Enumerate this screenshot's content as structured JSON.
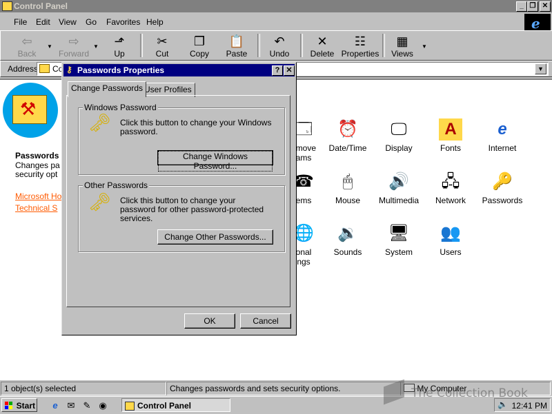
{
  "window": {
    "title": "Control Panel"
  },
  "menu": [
    "File",
    "Edit",
    "View",
    "Go",
    "Favorites",
    "Help"
  ],
  "toolbar": [
    {
      "label": "Back",
      "icon": "⇦",
      "disabled": true
    },
    {
      "label": "Forward",
      "icon": "⇨",
      "disabled": true
    },
    {
      "label": "Up",
      "icon": "⬏",
      "disabled": false
    },
    {
      "label": "Cut",
      "icon": "✂",
      "disabled": false
    },
    {
      "label": "Copy",
      "icon": "❐",
      "disabled": false
    },
    {
      "label": "Paste",
      "icon": "📋",
      "disabled": false
    },
    {
      "label": "Undo",
      "icon": "↶",
      "disabled": false
    },
    {
      "label": "Delete",
      "icon": "✕",
      "disabled": false
    },
    {
      "label": "Properties",
      "icon": "☷",
      "disabled": false
    },
    {
      "label": "Views",
      "icon": "▦",
      "disabled": false
    }
  ],
  "address": {
    "label": "Address",
    "value": "Co"
  },
  "sidebar": {
    "title": "Passwords",
    "desc_lines": [
      "Changes pa",
      "security opt"
    ],
    "links": [
      "Microsoft Ho",
      "Technical S"
    ]
  },
  "icons": [
    {
      "label": "emove",
      "label2": "ams",
      "glyph": "🗔"
    },
    {
      "label": "Date/Time",
      "glyph": "⏰"
    },
    {
      "label": "Display",
      "glyph": "🖵"
    },
    {
      "label": "Fonts",
      "glyph": "A"
    },
    {
      "label": "Internet",
      "glyph": "e"
    },
    {
      "label": "ems",
      "glyph": "☎"
    },
    {
      "label": "Mouse",
      "glyph": "🖱"
    },
    {
      "label": "Multimedia",
      "glyph": "🔊"
    },
    {
      "label": "Network",
      "glyph": "🖧"
    },
    {
      "label": "Passwords",
      "glyph": "🔑"
    },
    {
      "label": "onal",
      "label2": "ngs",
      "glyph": "🌐"
    },
    {
      "label": "Sounds",
      "glyph": "🔉"
    },
    {
      "label": "System",
      "glyph": "🖥"
    },
    {
      "label": "Users",
      "glyph": "👥"
    }
  ],
  "status": {
    "left": "1 object(s) selected",
    "mid": "Changes passwords and sets security options.",
    "right": "My Computer"
  },
  "taskbar": {
    "start": "Start",
    "task": "Control Panel",
    "clock": "12:41 PM"
  },
  "dialog": {
    "title": "Passwords Properties",
    "tabs": [
      "Change Passwords",
      "User Profiles"
    ],
    "windows_group": {
      "legend": "Windows Password",
      "text": "Click this button to change your Windows password.",
      "button": "Change Windows Password..."
    },
    "other_group": {
      "legend": "Other Passwords",
      "text": "Click this button to change your password for other password-protected services.",
      "button": "Change Other Passwords..."
    },
    "ok": "OK",
    "cancel": "Cancel"
  },
  "watermark": "The Collection Book"
}
